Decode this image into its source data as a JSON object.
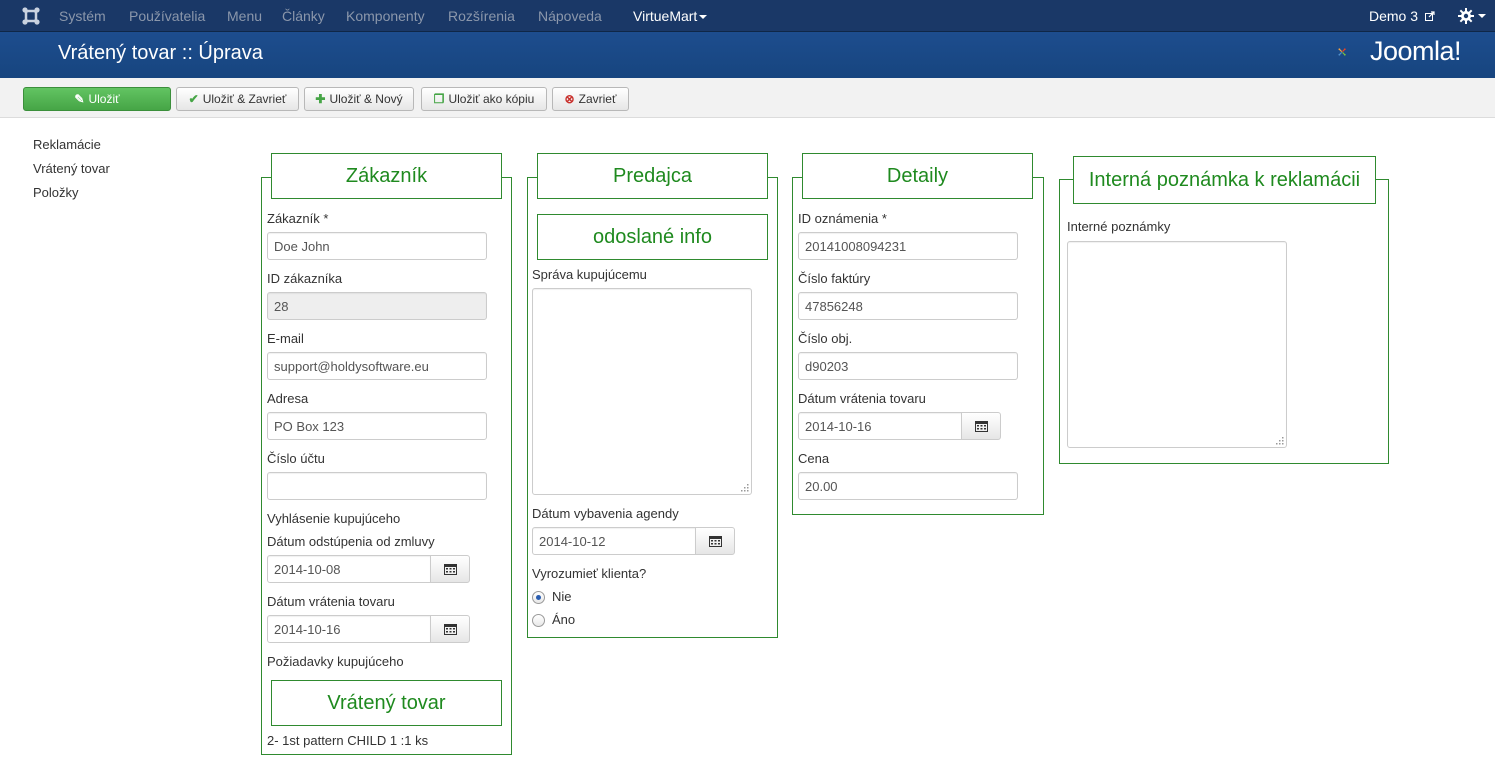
{
  "topmenu": {
    "items": [
      "Systém",
      "Používatelia",
      "Menu",
      "Články",
      "Komponenty",
      "Rozšírenia",
      "Nápoveda"
    ],
    "active": "VirtueMart",
    "user": "Demo 3"
  },
  "header": {
    "title": "Vrátený tovar :: Úprava",
    "logo_text": "Joomla!"
  },
  "toolbar": {
    "save": "Uložiť",
    "save_close": "Uložiť & Zavrieť",
    "save_new": "Uložiť & Nový",
    "save_copy": "Uložiť ako kópiu",
    "close": "Zavrieť"
  },
  "sidebar": {
    "items": [
      "Reklamácie",
      "Vrátený tovar",
      "Položky"
    ]
  },
  "customer": {
    "legend": "Zákazník",
    "name_label": "Zákazník *",
    "name_value": "Doe John",
    "id_label": "ID zákazníka",
    "id_value": "28",
    "email_label": "E-mail",
    "email_value": "support@holdysoftware.eu",
    "address_label": "Adresa",
    "address_value": "PO Box 123",
    "account_label": "Číslo účtu",
    "account_value": "",
    "declaration_label": "Vyhlásenie kupujúceho",
    "withdraw_label": "Dátum odstúpenia od zmluvy",
    "withdraw_value": "2014-10-08",
    "return_label": "Dátum vrátenia tovaru",
    "return_value": "2014-10-16",
    "requests_label": "Požiadavky kupujúceho",
    "returned_legend": "Vrátený tovar",
    "returned_item": "2- 1st pattern CHILD 1 :1 ks"
  },
  "seller": {
    "legend": "Predajca",
    "sent_legend": "odoslané info",
    "message_label": "Správa kupujúcemu",
    "message_value": "",
    "agenda_label": "Dátum vybavenia agendy",
    "agenda_value": "2014-10-12",
    "notify_label": "Vyrozumieť klienta?",
    "notify_options": [
      "Nie",
      "Áno"
    ],
    "notify_selected": "Nie"
  },
  "details": {
    "legend": "Detaily",
    "notice_label": "ID oznámenia *",
    "notice_value": "20141008094231",
    "invoice_label": "Číslo faktúry",
    "invoice_value": "47856248",
    "order_label": "Číslo obj.",
    "order_value": "d90203",
    "return_label": "Dátum vrátenia tovaru",
    "return_value": "2014-10-16",
    "price_label": "Cena",
    "price_value": "20.00"
  },
  "internal": {
    "legend": "Interná poznámka k reklamácii",
    "notes_label": "Interné poznámky",
    "notes_value": ""
  },
  "colors": {
    "topbar": "#1a3867",
    "header": "#1d4d8e",
    "legend_green": "#1f8a1f",
    "save_green": "#46a546"
  }
}
